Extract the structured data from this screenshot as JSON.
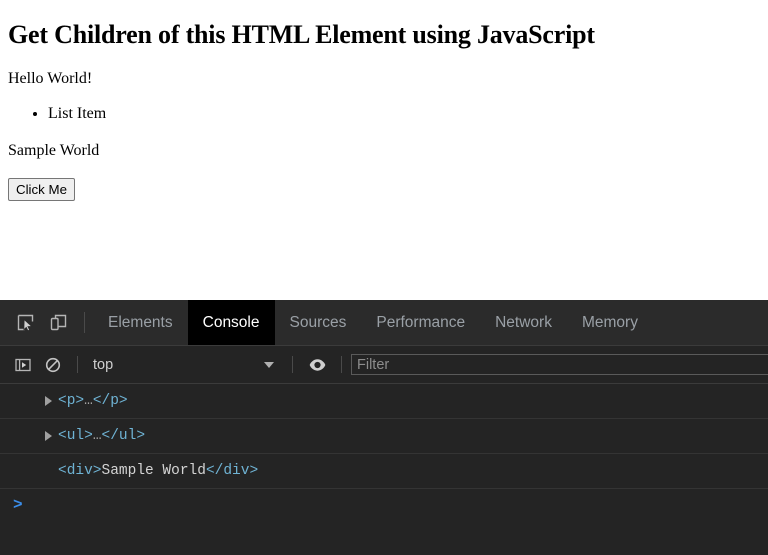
{
  "page": {
    "title": "Get Children of this HTML Element using JavaScript",
    "paragraph": "Hello World!",
    "list_items": [
      "List Item"
    ],
    "div_text": "Sample World",
    "button_label": "Click Me"
  },
  "devtools": {
    "tabs": [
      {
        "label": "Elements",
        "active": false
      },
      {
        "label": "Console",
        "active": true
      },
      {
        "label": "Sources",
        "active": false
      },
      {
        "label": "Performance",
        "active": false
      },
      {
        "label": "Network",
        "active": false
      },
      {
        "label": "Memory",
        "active": false
      }
    ],
    "toolbar_icons": [
      "inspect-element-icon",
      "device-toolbar-icon"
    ],
    "filter_bar": {
      "sidebar_toggle_icon": "console-sidebar-icon",
      "clear_icon": "clear-console-icon",
      "context": "top",
      "eye_icon": "live-expression-icon",
      "filter_placeholder": "Filter",
      "filter_value": ""
    },
    "console_rows": [
      {
        "expandable": true,
        "tag_open": "<p>",
        "ellipsis": "…",
        "tag_close": "</p>",
        "text": ""
      },
      {
        "expandable": true,
        "tag_open": "<ul>",
        "ellipsis": "…",
        "tag_close": "</ul>",
        "text": ""
      },
      {
        "expandable": false,
        "tag_open": "<div>",
        "ellipsis": "",
        "tag_close": "</div>",
        "text": "Sample World"
      }
    ],
    "prompt": ">"
  },
  "colors": {
    "devtools_bg": "#242424",
    "tabbar_bg": "#2b2b2b",
    "active_tab_bg": "#000000",
    "tag_blue": "#6fb3d4",
    "prompt_blue": "#3b8eea",
    "inactive_tab_text": "#9aa0a6"
  }
}
